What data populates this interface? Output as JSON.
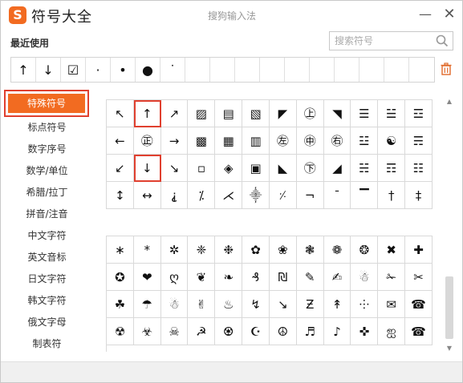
{
  "window": {
    "logo_char": "S",
    "app_title": "符号大全",
    "ime_title": "搜狗输入法",
    "minimize": "—",
    "close": "✕"
  },
  "recent": {
    "label": "最近使用",
    "symbols": [
      "↑",
      "↓",
      "☑",
      "·",
      "•",
      "●",
      "˙",
      "",
      "",
      "",
      "",
      "",
      "",
      "",
      "",
      "",
      ""
    ]
  },
  "search": {
    "placeholder": "搜索符号"
  },
  "sidebar": {
    "items": [
      {
        "label": "特殊符号",
        "active": true
      },
      {
        "label": "标点符号"
      },
      {
        "label": "数字序号"
      },
      {
        "label": "数学/单位"
      },
      {
        "label": "希腊/拉丁"
      },
      {
        "label": "拼音/注音"
      },
      {
        "label": "中文字符"
      },
      {
        "label": "英文音标"
      },
      {
        "label": "日文字符"
      },
      {
        "label": "韩文字符"
      },
      {
        "label": "俄文字母"
      },
      {
        "label": "制表符"
      }
    ]
  },
  "grid1": [
    [
      "↖",
      "↑",
      "↗",
      "▨",
      "▤",
      "▧",
      "◤",
      "㊤",
      "◥",
      "☰",
      "☱",
      "☲"
    ],
    [
      "←",
      "㊣",
      "→",
      "▩",
      "▦",
      "▥",
      "㊧",
      "㊥",
      "㊨",
      "☳",
      "☯",
      "☴"
    ],
    [
      "↙",
      "↓",
      "↘",
      "▫",
      "◈",
      "▣",
      "◣",
      "㊦",
      "◢",
      "☵",
      "☶",
      "☷"
    ],
    [
      "↕",
      "↔",
      "⸘",
      "⁒",
      "⋌",
      "⸎",
      "⸓",
      "¬",
      "¯",
      "▔",
      "†",
      "‡"
    ]
  ],
  "grid1_selected": [
    "0-1",
    "2-1"
  ],
  "grid2": [
    [
      "∗",
      "*",
      "✲",
      "❈",
      "❉",
      "✿",
      "❀",
      "❃",
      "❁",
      "❂",
      "✖",
      "✚"
    ],
    [
      "✪",
      "❤",
      "ღ",
      "❦",
      "❧",
      "₰",
      "₪",
      "✎",
      "✍",
      "☃",
      "✁",
      "✂"
    ],
    [
      "☘",
      "☂",
      "☃",
      "✌",
      "♨",
      "↯",
      "↘",
      "Ƶ",
      "↟",
      "⸭",
      "✉",
      "☎"
    ],
    [
      "☢",
      "☣",
      "☠",
      "☭",
      "♼",
      "☪",
      "☮",
      "♬",
      "♪",
      "✜",
      "ஐ",
      "☎"
    ]
  ]
}
